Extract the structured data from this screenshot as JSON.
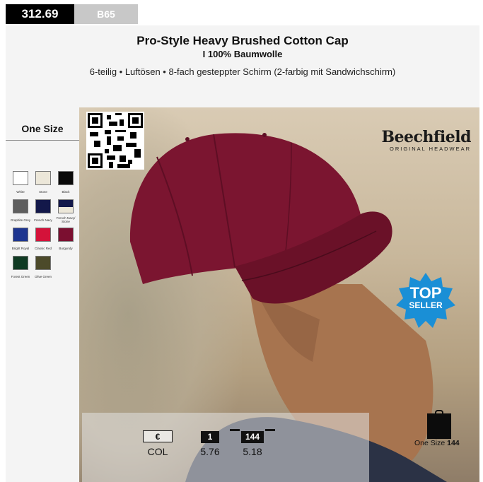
{
  "header": {
    "code": "312.69",
    "sku": "B65",
    "title": "Pro-Style Heavy Brushed Cotton Cap",
    "subtitle": "I 100% Baumwolle",
    "features": "6-teilig • Luftösen • 8-fach gesteppter Schirm (2-farbig mit Sandwichschirm)"
  },
  "sizes": {
    "title": "One Size"
  },
  "colors": [
    {
      "name": "White",
      "hex": "#ffffff"
    },
    {
      "name": "Stone",
      "hex": "#ece7d9"
    },
    {
      "name": "Black",
      "hex": "#0a0a0a"
    },
    {
      "name": "Graphite Grey",
      "hex": "#5e5e5e"
    },
    {
      "name": "French Navy",
      "hex": "#13184a"
    },
    {
      "name": "French Navy/ Stone",
      "hex": "#13184a",
      "accent": "#ece7d9"
    },
    {
      "name": "Bright Royal",
      "hex": "#1d3590"
    },
    {
      "name": "Classic Red",
      "hex": "#d4123a"
    },
    {
      "name": "Burgundy",
      "hex": "#7b0f30"
    },
    {
      "name": "Forest Green",
      "hex": "#0f3a23"
    },
    {
      "name": "Olive Green",
      "hex": "#4c4a2a"
    }
  ],
  "brand": {
    "name": "Beechfield",
    "tagline": "ORIGINAL HEADWEAR"
  },
  "badge": {
    "line1": "TOP",
    "line2": "SELLER",
    "color": "#1a8fd6"
  },
  "pricing": {
    "currency_label": "€",
    "col_label": "COL",
    "tiers": [
      {
        "qty": "1",
        "price": "5.76"
      },
      {
        "qty": "144",
        "price": "5.18"
      }
    ]
  },
  "packaging": {
    "size": "One Size",
    "qty": "144"
  },
  "cap_color": "#7b1530"
}
